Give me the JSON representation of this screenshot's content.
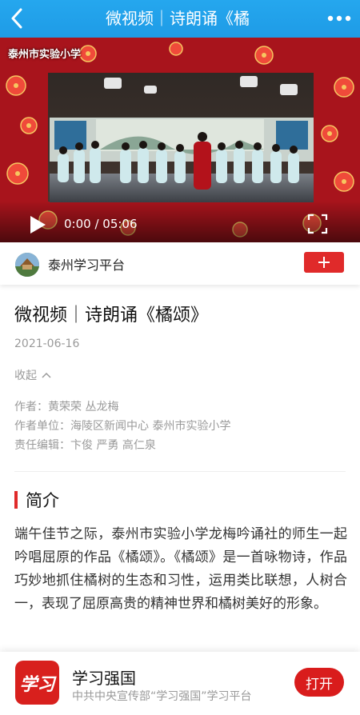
{
  "header": {
    "title": "微视频｜诗朗诵《橘",
    "back_icon": "chevron-left-icon",
    "more_icon": "more-dots-icon"
  },
  "video": {
    "watermark": "泰州市实验小学",
    "time": "0:00 / 05:06",
    "play_icon": "play-icon",
    "fullscreen_icon": "fullscreen-icon"
  },
  "publisher": {
    "name": "泰州学习平台",
    "follow_icon": "plus-icon",
    "follow_color": "#e02a2a"
  },
  "article": {
    "title": "微视频｜诗朗诵《橘颂》",
    "date": "2021-06-16",
    "collapse_label": "收起",
    "author": "作者：黄荣荣 丛龙梅",
    "author_unit": "作者单位：海陵区新闻中心 泰州市实验小学",
    "editor": "责任编辑：卞俊 严勇 高仁泉"
  },
  "summary": {
    "heading": "简介",
    "text": "端午佳节之际，泰州市实验小学龙梅吟诵社的师生一起吟唱屈原的作品《橘颂》。《橘颂》是一首咏物诗，作品巧妙地抓住橘树的生态和习性，运用类比联想，人树合一，表现了屈原高贵的精神世界和橘树美好的形象。"
  },
  "app_banner": {
    "logo_text": "学习",
    "name": "学习强国",
    "description": "中共中央宣传部“学习强国”学习平台",
    "open_label": "打开"
  },
  "colors": {
    "header_blue": "#1e9be6",
    "accent_red": "#e02a2a"
  }
}
